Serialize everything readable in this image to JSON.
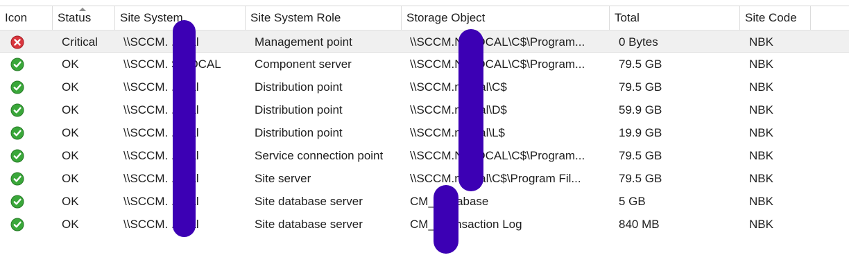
{
  "columns": {
    "icon": "Icon",
    "status": "Status",
    "site_system": "Site System",
    "role": "Site System Role",
    "storage": "Storage Object",
    "total": "Total",
    "site_code": "Site Code"
  },
  "sort": {
    "column": "Status",
    "direction": "ascending"
  },
  "colors": {
    "critical": "#d9363e",
    "ok": "#3aa73a",
    "redaction": "#3c00b4",
    "selected_row": "#f0f0f0"
  },
  "rows": [
    {
      "icon": "critical-icon",
      "status": "Critical",
      "site_system": "\\\\SCCM.       .local",
      "role": "Management point",
      "storage": "\\\\SCCM.N       .LOCAL\\C$\\Program...",
      "total": "0 Bytes",
      "site_code": "NBK"
    },
    {
      "icon": "ok-check-icon",
      "status": "OK",
      "site_system": "\\\\SCCM.       S.LOCAL",
      "role": "Component server",
      "storage": "\\\\SCCM.N       .LOCAL\\C$\\Program...",
      "total": "79.5 GB",
      "site_code": "NBK"
    },
    {
      "icon": "ok-check-icon",
      "status": "OK",
      "site_system": "\\\\SCCM.       .local",
      "role": "Distribution point",
      "storage": "\\\\SCCM.n       local\\C$",
      "total": "79.5 GB",
      "site_code": "NBK"
    },
    {
      "icon": "ok-check-icon",
      "status": "OK",
      "site_system": "\\\\SCCM.       .local",
      "role": "Distribution point",
      "storage": "\\\\SCCM.n       local\\D$",
      "total": "59.9 GB",
      "site_code": "NBK"
    },
    {
      "icon": "ok-check-icon",
      "status": "OK",
      "site_system": "\\\\SCCM.       .local",
      "role": "Distribution point",
      "storage": "\\\\SCCM.n       local\\L$",
      "total": "19.9 GB",
      "site_code": "NBK"
    },
    {
      "icon": "ok-check-icon",
      "status": "OK",
      "site_system": "\\\\SCCM.       .local",
      "role": "Service connection point",
      "storage": "\\\\SCCM.N       .LOCAL\\C$\\Program...",
      "total": "79.5 GB",
      "site_code": "NBK"
    },
    {
      "icon": "ok-check-icon",
      "status": "OK",
      "site_system": "\\\\SCCM.       .local",
      "role": "Site server",
      "storage": "\\\\SCCM.n       local\\C$\\Program Fil...",
      "total": "79.5 GB",
      "site_code": "NBK"
    },
    {
      "icon": "ok-check-icon",
      "status": "OK",
      "site_system": "\\\\SCCM.       .local",
      "role": "Site database server",
      "storage": "CM_          Database",
      "total": "5 GB",
      "site_code": "NBK"
    },
    {
      "icon": "ok-check-icon",
      "status": "OK",
      "site_system": "\\\\SCCM.       .local",
      "role": "Site database server",
      "storage": "CM_          Transaction Log",
      "total": "840 MB",
      "site_code": "NBK"
    }
  ]
}
